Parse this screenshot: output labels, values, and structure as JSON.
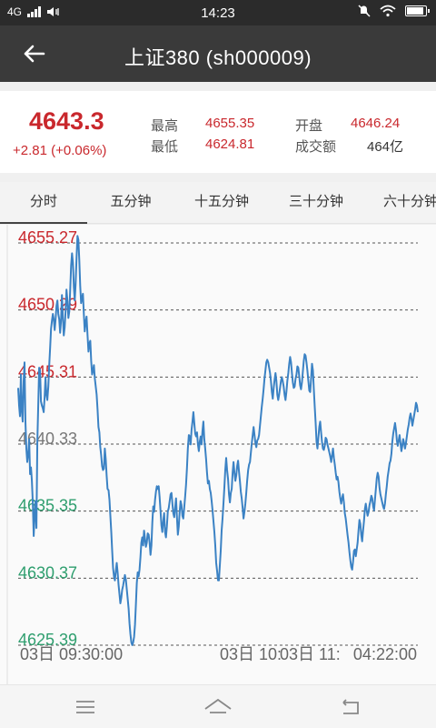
{
  "status_bar": {
    "time": "14:23",
    "network": "4G"
  },
  "header": {
    "title": "上证380 (sh000009)"
  },
  "quote": {
    "price": "4643.3",
    "change": "+2.81 (+0.06%)",
    "high_label": "最高",
    "high": "4655.35",
    "open_label": "开盘",
    "open": "4646.24",
    "low_label": "最低",
    "low": "4624.81",
    "volume_label": "成交额",
    "volume": "464亿"
  },
  "tabs": [
    {
      "label": "分时",
      "active": true
    },
    {
      "label": "五分钟"
    },
    {
      "label": "十五分钟"
    },
    {
      "label": "三十分钟"
    },
    {
      "label": "六十分钟"
    }
  ],
  "colors": {
    "up": "#c9282d",
    "down": "#2e9e6e",
    "flat": "#777777",
    "line": "#3b82c4"
  },
  "chart_data": {
    "type": "line",
    "y_ticks": [
      {
        "label": "4655.27",
        "value": 4655.27,
        "color": "up"
      },
      {
        "label": "4650.29",
        "value": 4650.29,
        "color": "up"
      },
      {
        "label": "4645.31",
        "value": 4645.31,
        "color": "up"
      },
      {
        "label": "4640.33",
        "value": 4640.33,
        "color": "flat"
      },
      {
        "label": "4635.35",
        "value": 4635.35,
        "color": "down"
      },
      {
        "label": "4630.37",
        "value": 4630.37,
        "color": "down"
      },
      {
        "label": "4625.39",
        "value": 4625.39,
        "color": "down"
      }
    ],
    "ylim": [
      4625.39,
      4655.27
    ],
    "x_labels": [
      "03日 09:30:00",
      "03日 10:",
      "03日 11:",
      "04:22:00"
    ],
    "x": [
      0,
      1,
      2,
      3,
      4,
      5,
      6,
      7,
      8,
      9,
      10,
      11,
      12,
      13,
      14,
      15,
      16,
      17,
      18,
      19,
      20,
      21,
      22,
      23,
      24,
      25,
      26,
      27,
      28,
      29,
      30,
      31,
      32,
      33,
      34,
      35,
      36,
      37,
      38,
      39,
      40,
      41,
      42,
      43,
      44,
      45,
      46,
      47,
      48,
      49,
      50,
      51,
      52,
      53,
      54,
      55,
      56,
      57,
      58,
      59,
      60,
      61,
      62,
      63,
      64,
      65,
      66,
      67,
      68,
      69,
      70,
      71,
      72,
      73,
      74,
      75,
      76,
      77,
      78,
      79,
      80,
      81,
      82,
      83,
      84,
      85,
      86,
      87,
      88,
      89,
      90,
      91,
      92,
      93,
      94,
      95,
      96,
      97,
      98,
      99,
      100,
      101,
      102,
      103,
      104,
      105,
      106,
      107,
      108,
      109,
      110,
      111,
      112,
      113,
      114,
      115,
      116,
      117,
      118,
      119,
      120,
      121,
      122,
      123,
      124,
      125,
      126,
      127,
      128,
      129,
      130,
      131,
      132,
      133,
      134,
      135,
      136,
      137,
      138,
      139,
      140,
      141,
      142,
      143,
      144,
      145,
      146,
      147,
      148,
      149,
      150,
      151,
      152,
      153,
      154,
      155,
      156,
      157,
      158,
      159,
      160,
      161,
      162,
      163,
      164,
      165,
      166,
      167,
      168,
      169,
      170,
      171,
      172,
      173,
      174,
      175,
      176,
      177,
      178,
      179,
      180,
      181,
      182,
      183,
      184,
      185,
      186,
      187,
      188,
      189,
      190,
      191,
      192,
      193,
      194,
      195,
      196,
      197,
      198,
      199,
      200,
      201,
      202,
      203,
      204,
      205,
      206,
      207,
      208,
      209,
      210,
      211,
      212,
      213,
      214,
      215,
      216,
      217,
      218,
      219,
      220,
      221,
      222,
      223,
      224,
      225,
      226,
      227,
      228,
      229,
      230,
      231,
      232,
      233,
      234,
      235,
      236,
      237,
      238,
      239,
      240,
      241,
      242,
      243,
      244,
      245,
      246,
      247,
      248,
      249,
      250,
      251,
      252,
      253,
      254,
      255,
      256,
      257,
      258,
      259,
      260,
      261,
      262,
      263,
      264,
      265,
      266,
      267,
      268,
      269,
      270,
      271,
      272,
      273,
      274,
      275,
      276,
      277,
      278,
      279,
      280,
      281,
      282,
      283,
      284,
      285,
      286,
      287,
      288,
      289,
      290,
      291,
      292,
      293,
      294,
      295,
      296,
      297,
      298,
      299,
      300,
      301,
      302,
      303,
      304,
      305,
      306,
      307,
      308,
      309,
      310,
      311,
      312,
      313,
      314,
      315,
      316,
      317,
      318,
      319,
      320,
      321,
      322,
      323,
      324,
      325,
      326,
      327,
      328,
      329,
      330,
      331,
      332,
      333,
      334,
      335,
      336,
      337,
      338,
      339,
      340,
      341,
      342,
      343,
      344,
      345,
      346,
      347,
      348,
      349,
      350,
      351,
      352,
      353,
      354,
      355,
      356,
      357,
      358,
      359,
      360,
      361,
      362,
      363,
      364,
      365,
      366,
      367,
      368,
      369,
      370,
      371,
      372,
      373,
      374,
      375,
      376,
      377,
      378,
      379,
      380,
      381,
      382,
      383,
      384,
      385,
      386,
      387,
      388,
      389,
      390,
      391,
      392,
      393,
      394,
      395,
      396,
      397,
      398,
      399,
      400,
      401,
      402,
      403,
      404,
      405,
      406,
      407,
      408,
      409,
      410,
      411,
      412,
      413,
      414,
      415,
      416,
      417,
      418,
      419,
      420,
      421,
      422,
      423,
      424,
      425,
      426,
      427,
      428,
      429,
      430,
      431,
      432,
      433,
      434,
      435,
      436,
      437,
      438
    ],
    "values": [
      4644.5,
      4643.2,
      4642.4,
      4645.5,
      4642.8,
      4642.0,
      4645.0,
      4646.4,
      4642.0,
      4640.0,
      4639.0,
      4639.6,
      4640.7,
      4638.1,
      4638.6,
      4637.6,
      4636.0,
      4633.5,
      4635.0,
      4636.1,
      4634.1,
      4640.5,
      4643.2,
      4646.0,
      4645.8,
      4643.5,
      4643.2,
      4643.0,
      4642.7,
      4643.8,
      4645.3,
      4644.0,
      4643.6,
      4644.6,
      4646.2,
      4647.5,
      4648.9,
      4649.5,
      4650.0,
      4649.6,
      4648.8,
      4649.6,
      4650.6,
      4651.0,
      4650.0,
      4649.6,
      4648.6,
      4649.5,
      4651.4,
      4649.8,
      4648.4,
      4649.0,
      4650.2,
      4651.8,
      4651.0,
      4649.7,
      4650.2,
      4651.8,
      4653.6,
      4654.5,
      4653.8,
      4652.0,
      4651.0,
      4652.3,
      4654.2,
      4655.8,
      4655.5,
      4654.0,
      4652.1,
      4650.8,
      4651.2,
      4651.5,
      4650.0,
      4648.7,
      4649.4,
      4649.8,
      4648.5,
      4647.2,
      4647.8,
      4648.0,
      4646.5,
      4645.5,
      4645.8,
      4646.2,
      4645.2,
      4644.6,
      4644.0,
      4642.9,
      4641.6,
      4641.2,
      4640.1,
      4639.5,
      4638.7,
      4638.4,
      4638.5,
      4640.0,
      4639.2,
      4638.0,
      4637.0,
      4636.9,
      4636.2,
      4635.0,
      4633.8,
      4632.4,
      4631.1,
      4630.5,
      4630.2,
      4630.9,
      4631.5,
      4630.8,
      4629.9,
      4629.2,
      4628.5,
      4628.9,
      4629.5,
      4629.8,
      4630.2,
      4630.6,
      4630.3,
      4629.6,
      4628.9,
      4628.1,
      4627.0,
      4626.2,
      4625.6,
      4625.4,
      4625.6,
      4626.0,
      4626.9,
      4628.4,
      4630.0,
      4630.8,
      4630.5,
      4631.0,
      4631.9,
      4633.0,
      4633.4,
      4632.8,
      4633.9,
      4633.3,
      4632.7,
      4633.0,
      4633.7,
      4633.6,
      4633.0,
      4632.1,
      4632.8,
      4634.5,
      4635.7,
      4635.3,
      4636.2,
      4636.8,
      4637.2,
      4637.0,
      4637.2,
      4636.4,
      4635.4,
      4634.3,
      4633.8,
      4634.6,
      4635.2,
      4633.8,
      4633.4,
      4634.2,
      4635.3,
      4635.6,
      4636.1,
      4636.6,
      4636.7,
      4635.9,
      4635.2,
      4634.9,
      4635.6,
      4636.3,
      4634.9,
      4633.6,
      4634.2,
      4635.3,
      4636.1,
      4635.8,
      4635.0,
      4634.8,
      4635.6,
      4636.4,
      4637.3,
      4638.5,
      4640.0,
      4641.0,
      4640.9,
      4640.3,
      4641.4,
      4642.0,
      4642.7,
      4641.9,
      4641.1,
      4640.9,
      4641.2,
      4640.3,
      4639.8,
      4640.5,
      4640.9,
      4640.3,
      4641.3,
      4642.0,
      4640.7,
      4640.0,
      4639.2,
      4638.2,
      4637.4,
      4637.6,
      4637.0,
      4636.7,
      4636.1,
      4635.4,
      4634.6,
      4633.8,
      4632.8,
      4631.5,
      4630.9,
      4630.2,
      4630.2,
      4631.3,
      4632.4,
      4633.9,
      4634.8,
      4635.9,
      4637.1,
      4638.4,
      4639.3,
      4638.4,
      4637.7,
      4636.6,
      4636.0,
      4636.7,
      4637.0,
      4638.2,
      4639.0,
      4638.2,
      4637.6,
      4638.0,
      4638.7,
      4639.1,
      4638.3,
      4637.6,
      4636.8,
      4636.3,
      4635.6,
      4634.8,
      4635.3,
      4635.9,
      4636.7,
      4637.6,
      4638.4,
      4638.8,
      4639.0,
      4639.7,
      4640.4,
      4641.0,
      4641.6,
      4641.0,
      4640.4,
      4640.1,
      4640.6,
      4640.7,
      4641.0,
      4641.7,
      4642.4,
      4643.1,
      4643.7,
      4644.4,
      4645.2,
      4645.8,
      4646.4,
      4646.6,
      4646.4,
      4646.0,
      4645.6,
      4645.0,
      4644.2,
      4643.7,
      4644.5,
      4645.1,
      4645.6,
      4645.0,
      4644.0,
      4643.6,
      4644.0,
      4644.5,
      4645.0,
      4645.3,
      4645.0,
      4644.6,
      4644.0,
      4643.6,
      4644.2,
      4645.0,
      4645.6,
      4646.3,
      4646.8,
      4646.4,
      4645.6,
      4644.9,
      4644.5,
      4644.6,
      4645.2,
      4645.5,
      4646.1,
      4646.0,
      4645.4,
      4644.7,
      4644.4,
      4644.9,
      4645.7,
      4646.5,
      4647.0,
      4646.9,
      4646.4,
      4645.8,
      4645.0,
      4644.3,
      4644.2,
      4645.2,
      4646.3,
      4645.8,
      4644.4,
      4643.1,
      4641.9,
      4640.5,
      4640.0,
      4640.8,
      4641.6,
      4642.0,
      4641.2,
      4640.5,
      4640.0,
      4639.9,
      4640.2,
      4640.8,
      4640.7,
      4640.3,
      4640.0,
      4639.7,
      4639.4,
      4639.0,
      4639.5,
      4640.0,
      4639.3,
      4638.8,
      4638.2,
      4637.7,
      4637.9,
      4637.5,
      4636.8,
      4636.3,
      4635.9,
      4636.3,
      4636.6,
      4636.0,
      4635.2,
      4634.8,
      4634.2,
      4633.6,
      4633.0,
      4632.3,
      4631.7,
      4631.2,
      4631.0,
      4631.6,
      4632.4,
      4632.5,
      4632.0,
      4632.5,
      4633.0,
      4633.9,
      4634.7,
      4634.4,
      4633.6,
      4633.1,
      4633.9,
      4634.6,
      4635.5,
      4635.9,
      4635.4,
      4635.0,
      4635.3,
      4635.8,
      4636.1,
      4636.5,
      4636.3,
      4635.7,
      4635.4,
      4636.2,
      4637.0,
      4637.8,
      4638.2,
      4637.9,
      4637.1,
      4636.6,
      4636.3,
      4636.0,
      4635.7,
      4635.5,
      4635.9,
      4636.6,
      4637.2,
      4637.9,
      4638.4,
      4638.9,
      4639.1,
      4639.6,
      4640.5,
      4641.1,
      4641.5,
      4641.9,
      4641.4,
      4640.6,
      4640.2,
      4640.6,
      4641.0,
      4640.4,
      4639.8,
      4640.2,
      4640.7,
      4640.4,
      4640.0,
      4640.4,
      4640.9,
      4641.4,
      4641.8,
      4642.3,
      4642.6,
      4642.2,
      4641.7,
      4642.1,
      4642.5,
      4642.9,
      4643.4,
      4643.2,
      4642.7,
      4642.6,
      4642.8
    ]
  },
  "nav": {
    "menu": "menu-icon",
    "home": "home-icon",
    "back": "back-icon"
  }
}
